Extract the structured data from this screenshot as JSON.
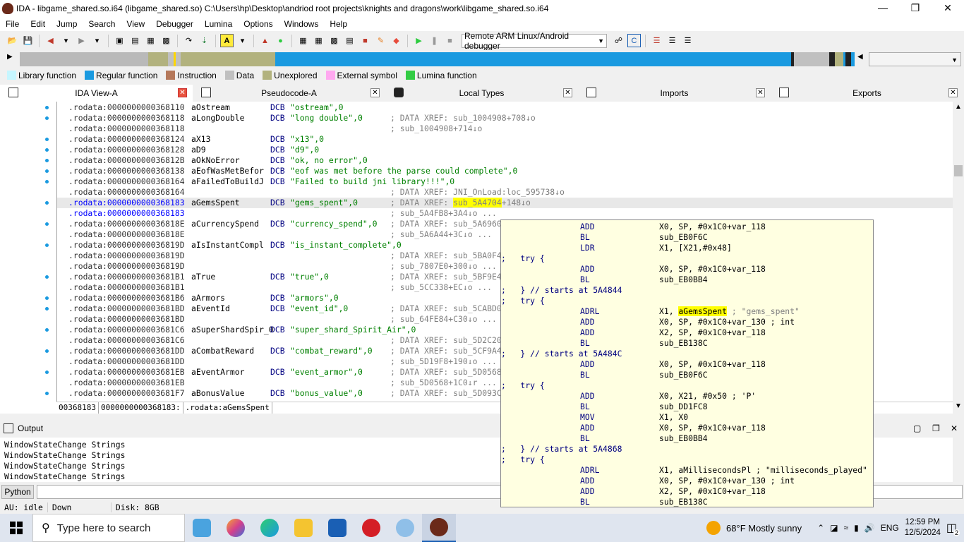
{
  "window": {
    "title": "IDA - libgame_shared.so.i64 (libgame_shared.so) C:\\Users\\hp\\Desktop\\andriod root projects\\knights and dragons\\work\\libgame_shared.so.i64",
    "minimize": "—",
    "maximize": "❐",
    "close": "✕"
  },
  "menu": [
    "File",
    "Edit",
    "Jump",
    "Search",
    "View",
    "Debugger",
    "Lumina",
    "Options",
    "Windows",
    "Help"
  ],
  "toolbar": {
    "debugger_select": "Remote ARM Linux/Android debugger",
    "icons": [
      "open-icon",
      "save-icon",
      "back-arrow-icon",
      "forward-arrow-icon",
      "hex-icon",
      "text-icon",
      "struct-icon",
      "enum-icon",
      "jump-icon",
      "string-icon",
      "graph-icon",
      "run-icon",
      "stop-icon"
    ]
  },
  "nav_combo": "",
  "legend": [
    {
      "label": "Library function",
      "color": "#c6f6ff"
    },
    {
      "label": "Regular function",
      "color": "#1a9ae0"
    },
    {
      "label": "Instruction",
      "color": "#b5785a"
    },
    {
      "label": "Data",
      "color": "#c0c0c0"
    },
    {
      "label": "Unexplored",
      "color": "#b2b27e"
    },
    {
      "label": "External symbol",
      "color": "#ffa8f0"
    },
    {
      "label": "Lumina function",
      "color": "#33cc44"
    }
  ],
  "tabs": [
    "IDA View-A",
    "Pseudocode-A",
    "Local Types",
    "Imports",
    "Exports"
  ],
  "listing": [
    {
      "addr": ".rodata:0000000000368110",
      "lbl": "aOstream",
      "ins": "DCB",
      "opr": "\"ostream\",0",
      "cmt": ""
    },
    {
      "addr": ".rodata:0000000000368118",
      "lbl": "aLongDouble",
      "ins": "DCB",
      "opr": "\"long double\",0",
      "cmt": "; DATA XREF: sub_1004908+708↓o"
    },
    {
      "addr": ".rodata:0000000000368118",
      "lbl": "",
      "ins": "",
      "opr": "",
      "cmt": "; sub_1004908+714↓o"
    },
    {
      "addr": ".rodata:0000000000368124",
      "lbl": "aX13",
      "ins": "DCB",
      "opr": "\"x13\",0",
      "cmt": ""
    },
    {
      "addr": ".rodata:0000000000368128",
      "lbl": "aD9",
      "ins": "DCB",
      "opr": "\"d9\",0",
      "cmt": ""
    },
    {
      "addr": ".rodata:000000000036812B",
      "lbl": "aOkNoError",
      "ins": "DCB",
      "opr": "\"ok, no error\",0",
      "cmt": ""
    },
    {
      "addr": ".rodata:0000000000368138",
      "lbl": "aEofWasMetBefor",
      "ins": "DCB",
      "opr": "\"eof was met before the parse could complete\",0",
      "cmt": ""
    },
    {
      "addr": ".rodata:0000000000368164",
      "lbl": "aFailedToBuildJ",
      "ins": "DCB",
      "opr": "\"Failed to build jni library!!!\",0",
      "cmt": ""
    },
    {
      "addr": ".rodata:0000000000368164",
      "lbl": "",
      "ins": "",
      "opr": "",
      "cmt": "; DATA XREF: JNI_OnLoad:loc_595738↓o"
    },
    {
      "addr": ".rodata:0000000000368183",
      "lbl": "aGemsSpent",
      "ins": "DCB",
      "opr": "\"gems_spent\",0",
      "cmt": "; DATA XREF: sub_5A4704+148↓o",
      "cur": true
    },
    {
      "addr": ".rodata:0000000000368183",
      "lbl": "",
      "ins": "",
      "opr": "",
      "cmt": "; sub_5A4FB8+3A4↓o ..."
    },
    {
      "addr": ".rodata:000000000036818E",
      "lbl": "aCurrencySpend",
      "ins": "DCB",
      "opr": "\"currency_spend\",0",
      "cmt": "; DATA XREF: sub_5A6960"
    },
    {
      "addr": ".rodata:000000000036818E",
      "lbl": "",
      "ins": "",
      "opr": "",
      "cmt": "; sub_5A6A44+3C↓o ..."
    },
    {
      "addr": ".rodata:000000000036819D",
      "lbl": "aIsInstantCompl",
      "ins": "DCB",
      "opr": "\"is_instant_complete\",0",
      "cmt": ""
    },
    {
      "addr": ".rodata:000000000036819D",
      "lbl": "",
      "ins": "",
      "opr": "",
      "cmt": "; DATA XREF: sub_5BA0F4"
    },
    {
      "addr": ".rodata:000000000036819D",
      "lbl": "",
      "ins": "",
      "opr": "",
      "cmt": "; sub_7807E0+300↓o ..."
    },
    {
      "addr": ".rodata:00000000003681B1",
      "lbl": "aTrue",
      "ins": "DCB",
      "opr": "\"true\",0",
      "cmt": "; DATA XREF: sub_5BF9E4"
    },
    {
      "addr": ".rodata:00000000003681B1",
      "lbl": "",
      "ins": "",
      "opr": "",
      "cmt": "; sub_5CC338+EC↓o ..."
    },
    {
      "addr": ".rodata:00000000003681B6",
      "lbl": "aArmors",
      "ins": "DCB",
      "opr": "\"armors\",0",
      "cmt": ""
    },
    {
      "addr": ".rodata:00000000003681BD",
      "lbl": "aEventId",
      "ins": "DCB",
      "opr": "\"event_id\",0",
      "cmt": "; DATA XREF: sub_5CABD0"
    },
    {
      "addr": ".rodata:00000000003681BD",
      "lbl": "",
      "ins": "",
      "opr": "",
      "cmt": "; sub_64FE84+C30↓o ..."
    },
    {
      "addr": ".rodata:00000000003681C6",
      "lbl": "aSuperShardSpir_0",
      "ins": "DCB",
      "opr": "\"super_shard_Spirit_Air\",0",
      "cmt": ""
    },
    {
      "addr": ".rodata:00000000003681C6",
      "lbl": "",
      "ins": "",
      "opr": "",
      "cmt": "; DATA XREF: sub_5D2C20"
    },
    {
      "addr": ".rodata:00000000003681DD",
      "lbl": "aCombatReward",
      "ins": "DCB",
      "opr": "\"combat_reward\",0",
      "cmt": "; DATA XREF: sub_5CF9A4"
    },
    {
      "addr": ".rodata:00000000003681DD",
      "lbl": "",
      "ins": "",
      "opr": "",
      "cmt": "; sub_5D19F8+190↓o ..."
    },
    {
      "addr": ".rodata:00000000003681EB",
      "lbl": "aEventArmor",
      "ins": "DCB",
      "opr": "\"event_armor\",0",
      "cmt": "; DATA XREF: sub_5D0568"
    },
    {
      "addr": ".rodata:00000000003681EB",
      "lbl": "",
      "ins": "",
      "opr": "",
      "cmt": "; sub_5D0568+1C0↓r ..."
    },
    {
      "addr": ".rodata:00000000003681F7",
      "lbl": "aBonusValue",
      "ins": "DCB",
      "opr": "\"bonus_value\",0",
      "cmt": "; DATA XREF: sub_5D093C"
    }
  ],
  "listing_status": [
    "00368183",
    "0000000000368183:",
    ".rodata:aGemsSpent"
  ],
  "popup": [
    {
      "ins": "ADD",
      "opr": "X0, SP, #0x1C0+var_118"
    },
    {
      "ins": "BL",
      "opr": "sub_EB0F6C"
    },
    {
      "ins": "LDR",
      "opr": "X1, [X21,#0x48]"
    },
    {
      "cm": ";   try {"
    },
    {
      "ins": "ADD",
      "opr": "X0, SP, #0x1C0+var_118"
    },
    {
      "ins": "BL",
      "opr": "sub_EB0BB4"
    },
    {
      "cm": ";   } // starts at 5A4844"
    },
    {
      "cm": ";   try {"
    },
    {
      "ins": "ADRL",
      "opr": "X1, ",
      "hl": "aGemsSpent",
      "cmt": " ; \"gems_spent\""
    },
    {
      "ins": "ADD",
      "opr": "X0, SP, #0x1C0+var_130 ; int"
    },
    {
      "ins": "ADD",
      "opr": "X2, SP, #0x1C0+var_118"
    },
    {
      "ins": "BL",
      "opr": "sub_EB138C"
    },
    {
      "cm": ";   } // starts at 5A484C"
    },
    {
      "ins": "ADD",
      "opr": "X0, SP, #0x1C0+var_118"
    },
    {
      "ins": "BL",
      "opr": "sub_EB0F6C"
    },
    {
      "cm": ";   try {"
    },
    {
      "ins": "ADD",
      "opr": "X0, X21, #0x50 ; 'P'"
    },
    {
      "ins": "BL",
      "opr": "sub_DD1FC8"
    },
    {
      "ins": "MOV",
      "opr": "X1, X0"
    },
    {
      "ins": "ADD",
      "opr": "X0, SP, #0x1C0+var_118"
    },
    {
      "ins": "BL",
      "opr": "sub_EB0BB4"
    },
    {
      "cm": ";   } // starts at 5A4868"
    },
    {
      "cm": ";   try {"
    },
    {
      "ins": "ADRL",
      "opr": "X1, aMillisecondsPl ; \"milliseconds_played\""
    },
    {
      "ins": "ADD",
      "opr": "X0, SP, #0x1C0+var_130 ; int"
    },
    {
      "ins": "ADD",
      "opr": "X2, SP, #0x1C0+var_118"
    },
    {
      "ins": "BL",
      "opr": "sub_EB138C"
    }
  ],
  "output": {
    "title": "Output",
    "lines": [
      "WindowStateChange Strings",
      "WindowStateChange Strings",
      "WindowStateChange Strings",
      "WindowStateChange Strings"
    ]
  },
  "python_btn": "Python",
  "ida_status": [
    "AU:  idle",
    "Down",
    "Disk: 8GB"
  ],
  "taskbar": {
    "search_placeholder": "Type here to search",
    "weather": "68°F  Mostly sunny",
    "lang": "ENG",
    "time": "12:59 PM",
    "date": "12/5/2024",
    "notif_count": "2"
  }
}
